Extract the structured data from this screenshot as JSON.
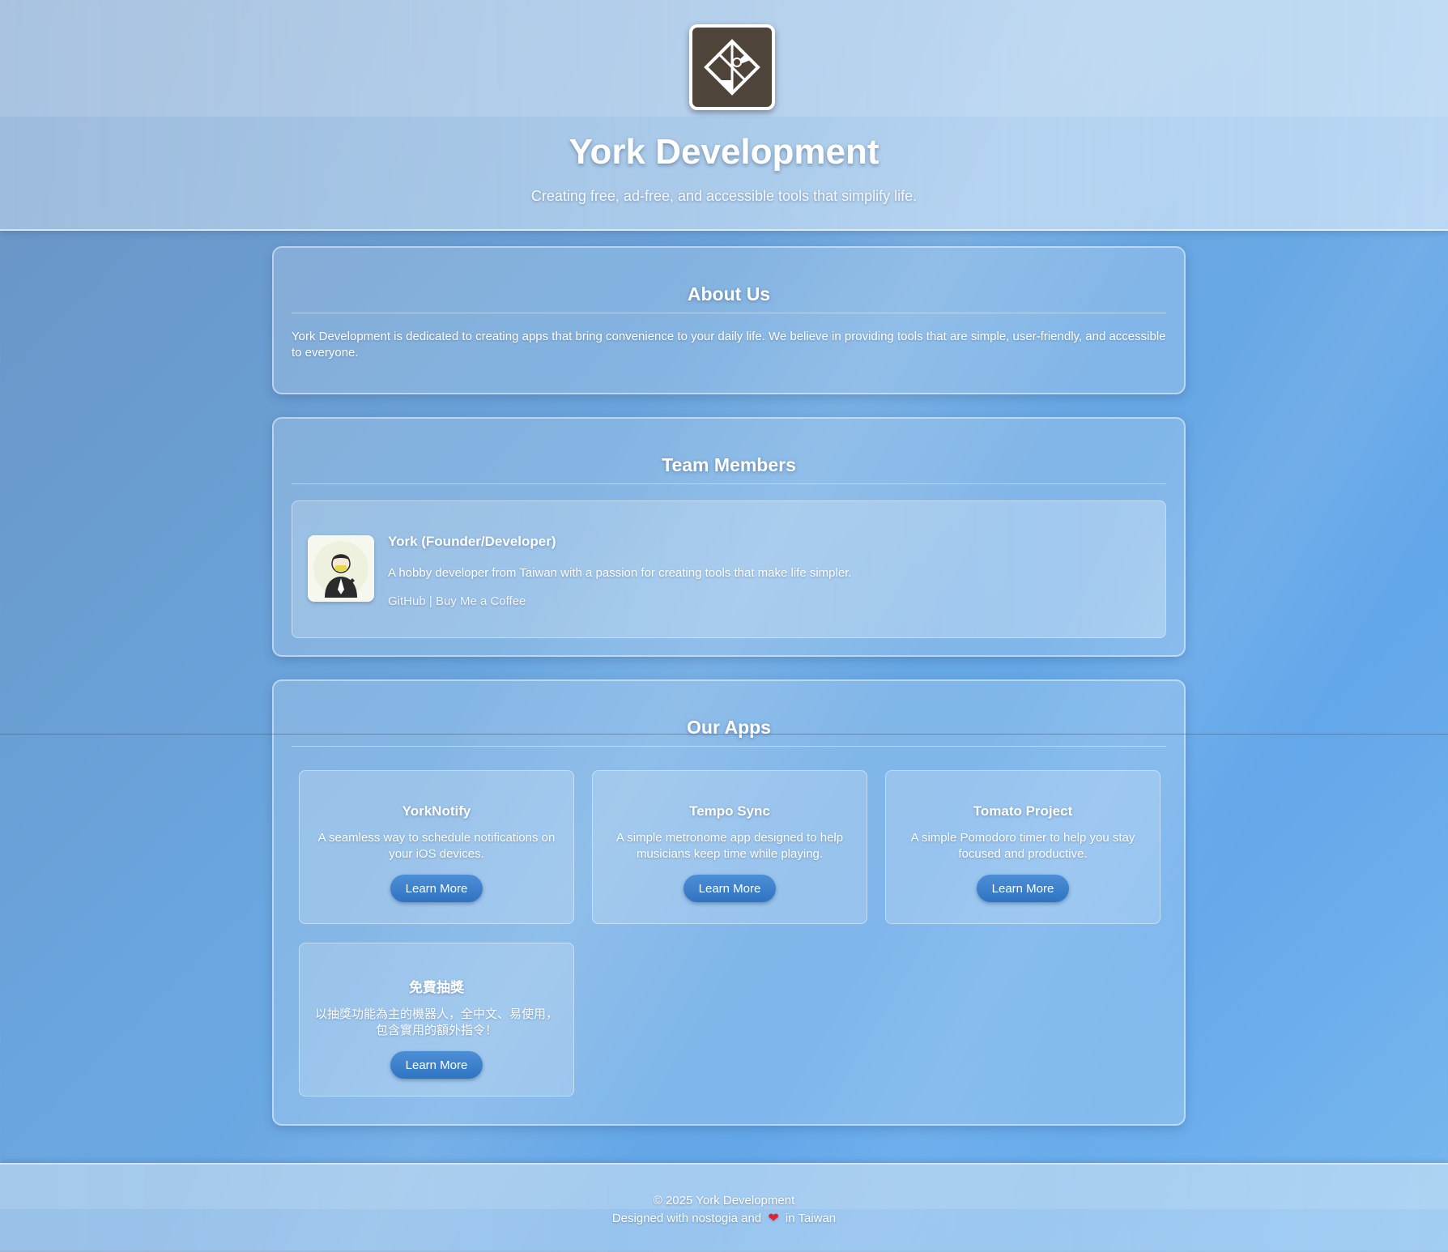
{
  "header": {
    "title": "York Development",
    "tagline": "Creating free, ad-free, and accessible tools that simplify life."
  },
  "about": {
    "heading": "About Us",
    "text": "York Development is dedicated to creating apps that bring convenience to your daily life. We believe in providing tools that are simple, user-friendly, and accessible to everyone."
  },
  "team": {
    "heading": "Team Members",
    "members": [
      {
        "name": "York (Founder/Developer)",
        "bio": "A hobby developer from Taiwan with a passion for creating tools that make life simpler.",
        "links": {
          "github": "GitHub",
          "separator": "|",
          "coffee": "Buy Me a Coffee"
        }
      }
    ]
  },
  "apps": {
    "heading": "Our Apps",
    "items": [
      {
        "name": "YorkNotify",
        "description": "A seamless way to schedule notifications on your iOS devices.",
        "button": "Learn More"
      },
      {
        "name": "Tempo Sync",
        "description": "A simple metronome app designed to help musicians keep time while playing.",
        "button": "Learn More"
      },
      {
        "name": "Tomato Project",
        "description": "A simple Pomodoro timer to help you stay focused and productive.",
        "button": "Learn More"
      },
      {
        "name": "免費抽獎",
        "description": "以抽獎功能為主的機器人，全中文、易使用，包含實用的額外指令！",
        "button": "Learn More"
      }
    ]
  },
  "footer": {
    "copyright": "© 2025 York Development",
    "credit_before": "Designed with nostogia and",
    "credit_after": "in Taiwan",
    "heart_icon": "heart-icon"
  },
  "colors": {
    "button": "#3a7fca",
    "logo_bg": "#4f4439",
    "heart": "#e0232f"
  }
}
